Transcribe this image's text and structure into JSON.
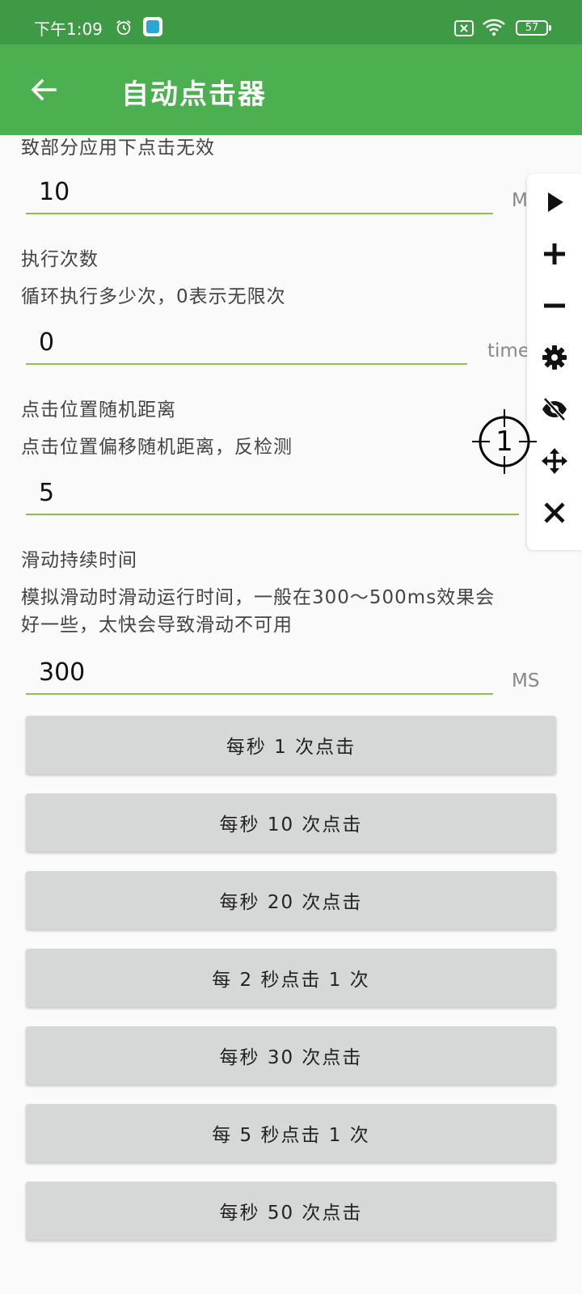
{
  "status_bar": {
    "time": "下午1:09",
    "battery": "57"
  },
  "app_bar": {
    "title": "自动点击器"
  },
  "settings": {
    "interval_desc_tail": "致部分应用下点击无效",
    "interval_value": "10",
    "interval_unit": "MS",
    "repeat_title": "执行次数",
    "repeat_desc": "循环执行多少次，0表示无限次",
    "repeat_value": "0",
    "repeat_unit": "time",
    "random_title": "点击位置随机距离",
    "random_desc": "点击位置偏移随机距离，反检测",
    "random_value": "5",
    "swipe_title": "滑动持续时间",
    "swipe_desc_line1": "模拟滑动时滑动运行时间，一般在300～500ms效果会",
    "swipe_desc_line2": "好一些，太快会导致滑动不可用",
    "swipe_value": "300",
    "swipe_unit": "MS"
  },
  "presets": [
    "每秒 1 次点击",
    "每秒 10 次点击",
    "每秒 20 次点击",
    "每 2 秒点击 1 次",
    "每秒 30 次点击",
    "每 5 秒点击 1 次",
    "每秒 50 次点击"
  ],
  "floating_toolbar": {
    "icons": [
      "play-icon",
      "plus-icon",
      "minus-icon",
      "gear-icon",
      "eye-off-icon",
      "move-icon",
      "close-icon"
    ]
  },
  "target": {
    "label": "1"
  },
  "colors": {
    "status_bar": "#3e9a44",
    "app_bar": "#4caf50",
    "field_underline": "#8bc34a",
    "button_bg": "#d6d7d7"
  }
}
